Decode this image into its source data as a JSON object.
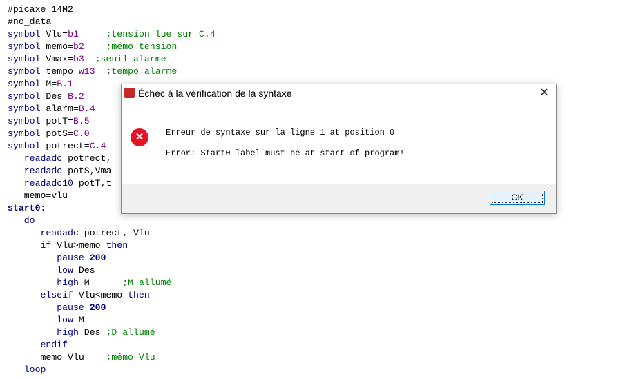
{
  "code": {
    "lines": [
      {
        "parts": [
          {
            "c": "",
            "t": "#picaxe 14M2"
          }
        ]
      },
      {
        "parts": [
          {
            "c": "",
            "t": "#no_data"
          }
        ]
      },
      {
        "parts": [
          {
            "c": "kw",
            "t": "symbol "
          },
          {
            "c": "",
            "t": "Vlu="
          },
          {
            "c": "nm",
            "t": "b1"
          },
          {
            "c": "",
            "t": "     "
          },
          {
            "c": "cm",
            "t": ";tension lue sur C.4"
          }
        ]
      },
      {
        "parts": [
          {
            "c": "kw",
            "t": "symbol "
          },
          {
            "c": "",
            "t": "memo="
          },
          {
            "c": "nm",
            "t": "b2"
          },
          {
            "c": "",
            "t": "    "
          },
          {
            "c": "cm",
            "t": ";mémo tension"
          }
        ]
      },
      {
        "parts": [
          {
            "c": "kw",
            "t": "symbol "
          },
          {
            "c": "",
            "t": "Vmax="
          },
          {
            "c": "nm",
            "t": "b3"
          },
          {
            "c": "",
            "t": "  "
          },
          {
            "c": "cm",
            "t": ";seuil alarme"
          }
        ]
      },
      {
        "parts": [
          {
            "c": "kw",
            "t": "symbol "
          },
          {
            "c": "",
            "t": "tempo="
          },
          {
            "c": "nm",
            "t": "w13"
          },
          {
            "c": "",
            "t": "  "
          },
          {
            "c": "cm",
            "t": ";tempo alarme"
          }
        ]
      },
      {
        "parts": [
          {
            "c": "kw",
            "t": "symbol "
          },
          {
            "c": "",
            "t": "M="
          },
          {
            "c": "nm",
            "t": "B.1"
          }
        ]
      },
      {
        "parts": [
          {
            "c": "kw",
            "t": "symbol "
          },
          {
            "c": "",
            "t": "Des="
          },
          {
            "c": "nm",
            "t": "B.2"
          }
        ]
      },
      {
        "parts": [
          {
            "c": "kw",
            "t": "symbol "
          },
          {
            "c": "",
            "t": "alarm="
          },
          {
            "c": "nm",
            "t": "B.4"
          }
        ]
      },
      {
        "parts": [
          {
            "c": "kw",
            "t": "symbol "
          },
          {
            "c": "",
            "t": "potT="
          },
          {
            "c": "nm",
            "t": "B.5"
          }
        ]
      },
      {
        "parts": [
          {
            "c": "kw",
            "t": "symbol "
          },
          {
            "c": "",
            "t": "potS="
          },
          {
            "c": "nm",
            "t": "C.0"
          }
        ]
      },
      {
        "parts": [
          {
            "c": "kw",
            "t": "symbol "
          },
          {
            "c": "",
            "t": "potrect="
          },
          {
            "c": "nm",
            "t": "C.4"
          }
        ]
      },
      {
        "parts": [
          {
            "c": "",
            "t": "   "
          },
          {
            "c": "kw",
            "t": "readadc"
          },
          {
            "c": "",
            "t": " potrect,"
          }
        ]
      },
      {
        "parts": [
          {
            "c": "",
            "t": "   "
          },
          {
            "c": "kw",
            "t": "readadc"
          },
          {
            "c": "",
            "t": " potS,Vma"
          }
        ]
      },
      {
        "parts": [
          {
            "c": "",
            "t": "   "
          },
          {
            "c": "kw",
            "t": "readadc10"
          },
          {
            "c": "",
            "t": " potT,t"
          }
        ]
      },
      {
        "parts": [
          {
            "c": "",
            "t": "   memo=vlu"
          }
        ]
      },
      {
        "parts": [
          {
            "c": "lbl",
            "t": "start0:"
          }
        ]
      },
      {
        "parts": [
          {
            "c": "",
            "t": "   "
          },
          {
            "c": "kw",
            "t": "do"
          }
        ]
      },
      {
        "parts": [
          {
            "c": "",
            "t": "      "
          },
          {
            "c": "kw",
            "t": "readadc"
          },
          {
            "c": "",
            "t": " potrect, Vlu"
          }
        ]
      },
      {
        "parts": [
          {
            "c": "",
            "t": "      "
          },
          {
            "c": "kw",
            "t": "if"
          },
          {
            "c": "",
            "t": " Vlu>memo "
          },
          {
            "c": "kw",
            "t": "then"
          }
        ]
      },
      {
        "parts": [
          {
            "c": "",
            "t": "         "
          },
          {
            "c": "kw",
            "t": "pause"
          },
          {
            "c": "",
            "t": " "
          },
          {
            "c": "nb",
            "t": "200"
          }
        ]
      },
      {
        "parts": [
          {
            "c": "",
            "t": "         "
          },
          {
            "c": "kw",
            "t": "low"
          },
          {
            "c": "",
            "t": " Des"
          }
        ]
      },
      {
        "parts": [
          {
            "c": "",
            "t": "         "
          },
          {
            "c": "kw",
            "t": "high"
          },
          {
            "c": "",
            "t": " M      "
          },
          {
            "c": "cm",
            "t": ";M allumé"
          }
        ]
      },
      {
        "parts": [
          {
            "c": "",
            "t": "      "
          },
          {
            "c": "kw",
            "t": "elseif"
          },
          {
            "c": "",
            "t": " Vlu<memo "
          },
          {
            "c": "kw",
            "t": "then"
          }
        ]
      },
      {
        "parts": [
          {
            "c": "",
            "t": "         "
          },
          {
            "c": "kw",
            "t": "pause"
          },
          {
            "c": "",
            "t": " "
          },
          {
            "c": "nb",
            "t": "200"
          }
        ]
      },
      {
        "parts": [
          {
            "c": "",
            "t": "         "
          },
          {
            "c": "kw",
            "t": "low"
          },
          {
            "c": "",
            "t": " M"
          }
        ]
      },
      {
        "parts": [
          {
            "c": "",
            "t": "         "
          },
          {
            "c": "kw",
            "t": "high"
          },
          {
            "c": "",
            "t": " Des "
          },
          {
            "c": "cm",
            "t": ";D allumé"
          }
        ]
      },
      {
        "parts": [
          {
            "c": "",
            "t": "      "
          },
          {
            "c": "kw",
            "t": "endif"
          }
        ]
      },
      {
        "parts": [
          {
            "c": "",
            "t": "      memo=Vlu    "
          },
          {
            "c": "cm",
            "t": ";mémo Vlu"
          }
        ]
      },
      {
        "parts": [
          {
            "c": "",
            "t": "   "
          },
          {
            "c": "kw",
            "t": "loop"
          }
        ]
      }
    ]
  },
  "dialog": {
    "title": "Échec à la vérification de la syntaxe",
    "close_glyph": "✕",
    "error_glyph": "✕",
    "message_line1": "Erreur de syntaxe sur la ligne 1 at position 0",
    "message_line2": "Error: Start0 label must be at start of program!",
    "ok_label": "OK"
  }
}
